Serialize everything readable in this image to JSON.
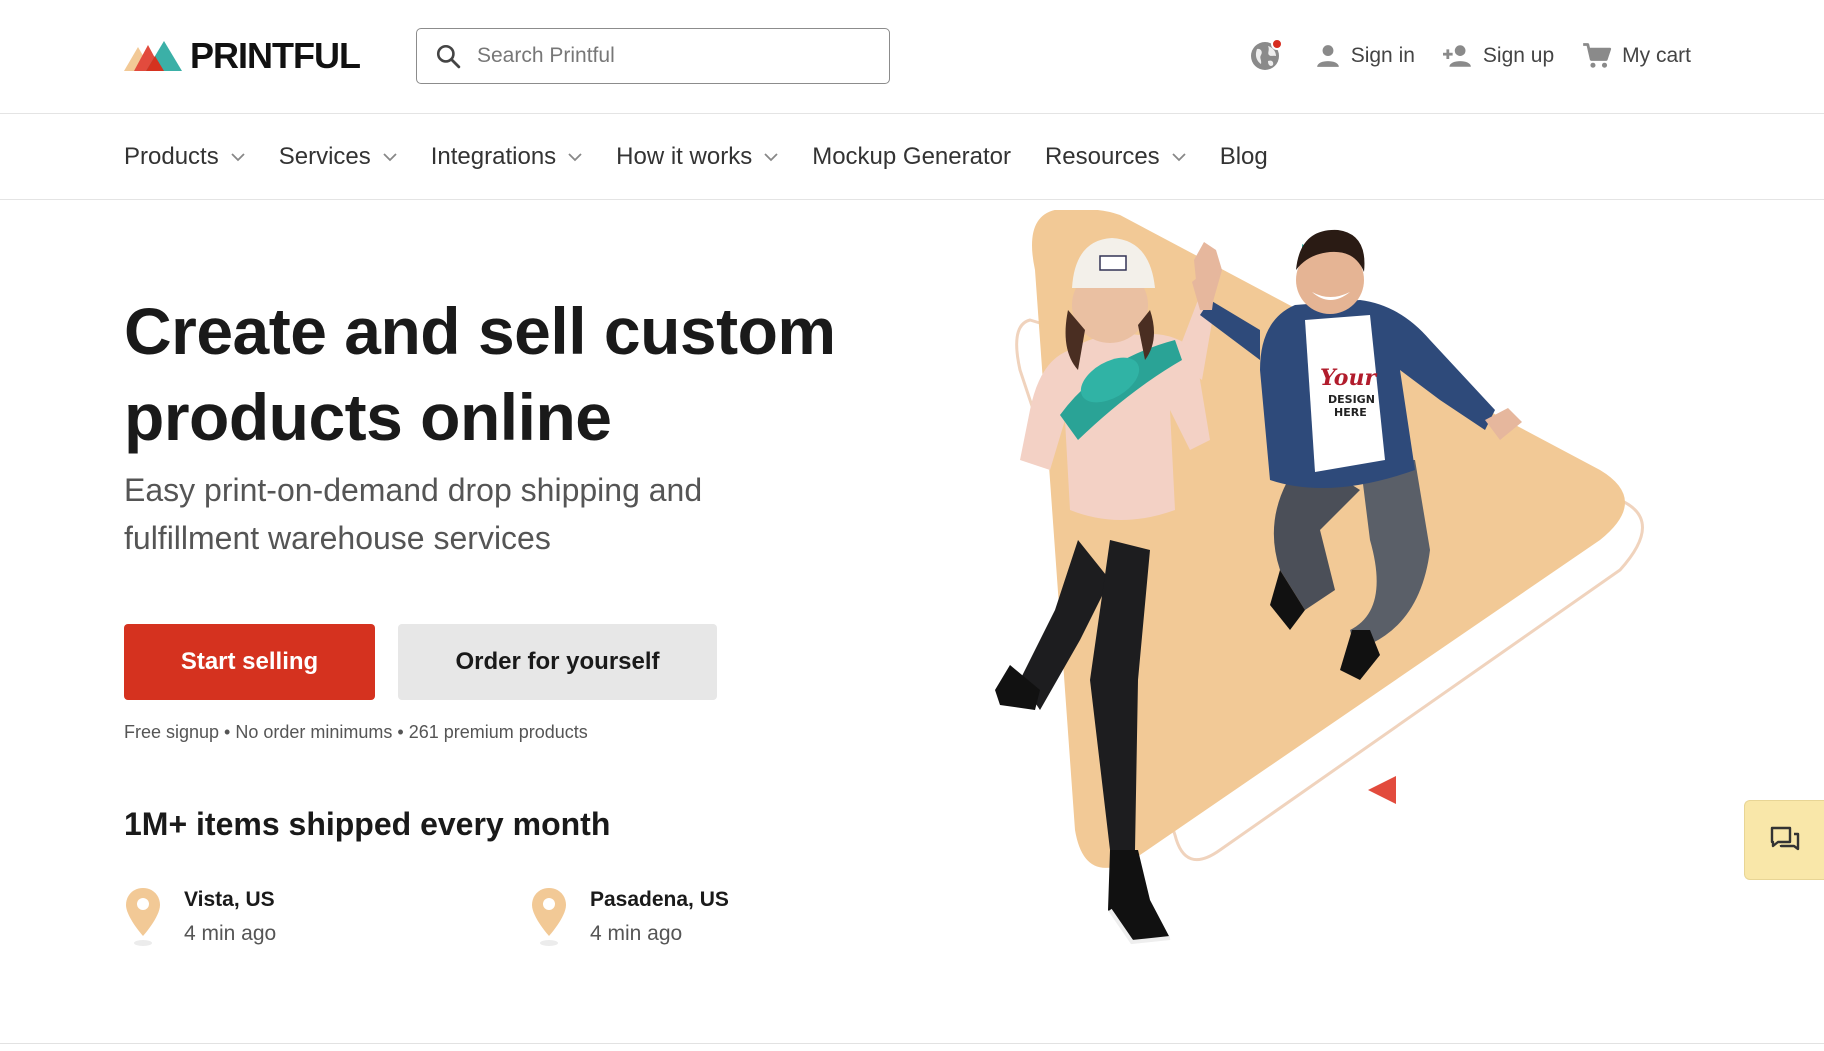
{
  "brand": {
    "name": "PRINTFUL",
    "colors": {
      "accent_red": "#d5321f",
      "teal": "#3bb0a7",
      "sand": "#f2c996",
      "chat_bg": "#f9e7a9"
    }
  },
  "search": {
    "placeholder": "Search Printful",
    "icon": "search-icon"
  },
  "utilities": {
    "language_icon": "globe-icon",
    "sign_in": "Sign in",
    "sign_up": "Sign up",
    "cart": "My cart"
  },
  "nav": {
    "items": [
      {
        "label": "Products",
        "has_dropdown": true
      },
      {
        "label": "Services",
        "has_dropdown": true
      },
      {
        "label": "Integrations",
        "has_dropdown": true
      },
      {
        "label": "How it works",
        "has_dropdown": true
      },
      {
        "label": "Mockup Generator",
        "has_dropdown": false
      },
      {
        "label": "Resources",
        "has_dropdown": true
      },
      {
        "label": "Blog",
        "has_dropdown": false
      }
    ]
  },
  "hero": {
    "title_line1": "Create and sell custom",
    "title_line2": "products online",
    "subtitle_line1": "Easy print-on-demand drop shipping and",
    "subtitle_line2": "fulfillment warehouse services",
    "primary_cta": "Start selling",
    "secondary_cta": "Order for yourself",
    "perks": "Free signup • No order minimums • 261 premium products"
  },
  "shipping": {
    "title": "1M+ items shipped every month",
    "locations": [
      {
        "name": "Vista, US",
        "time": "4 min ago"
      },
      {
        "name": "Pasadena, US",
        "time": "4 min ago"
      }
    ]
  },
  "illustration": {
    "shirt_text_1": "Your",
    "shirt_text_2": "DESIGN",
    "shirt_text_3": "HERE"
  },
  "chat": {
    "icon": "chat-icon"
  }
}
